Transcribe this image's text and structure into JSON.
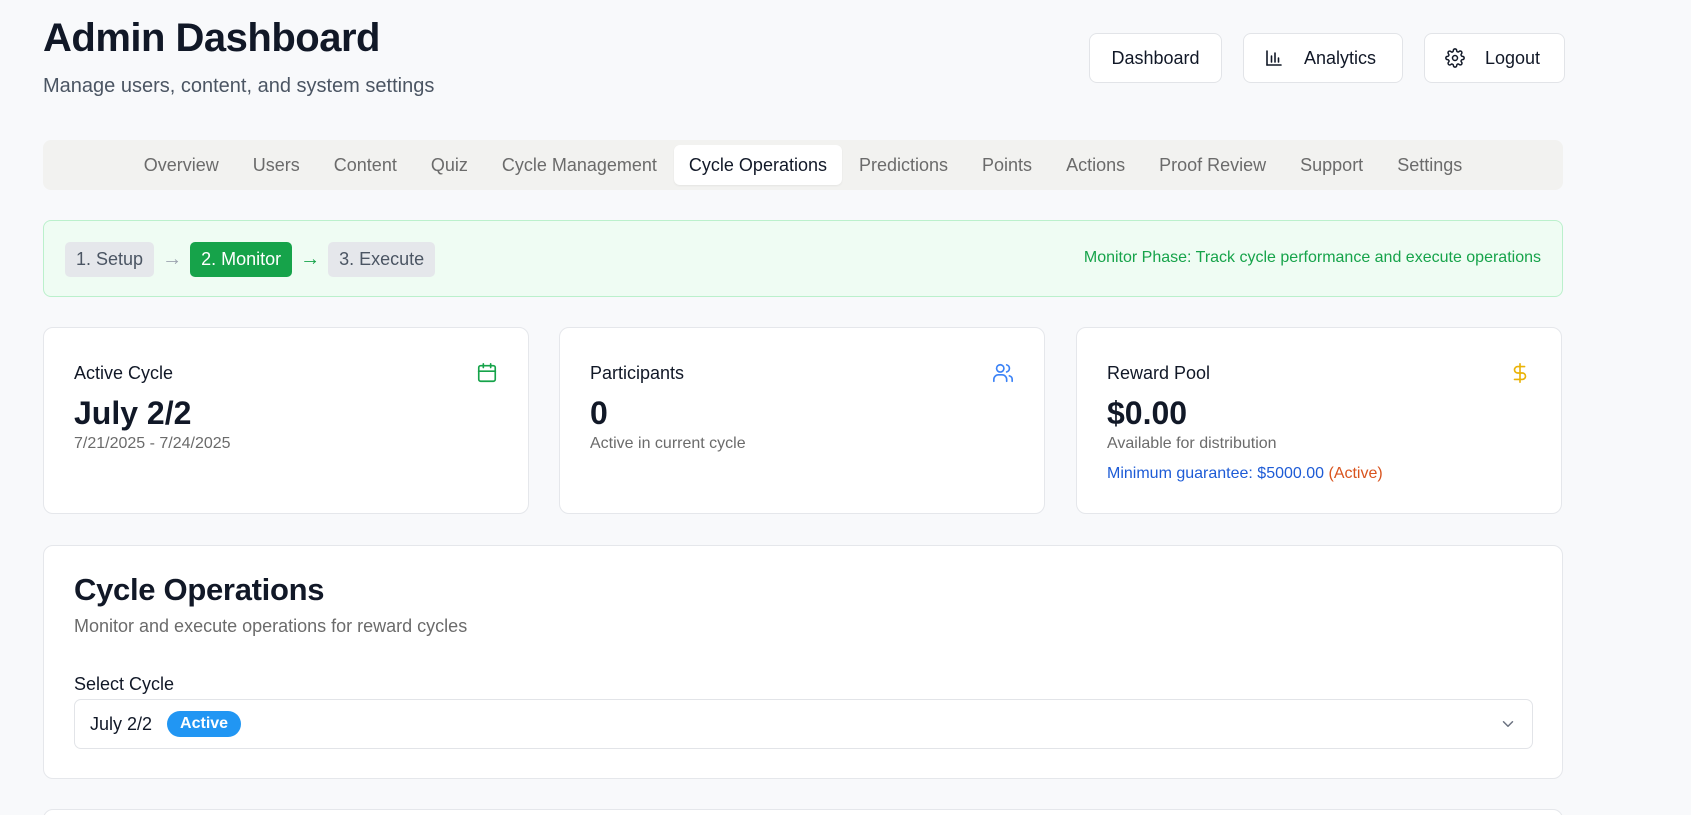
{
  "header": {
    "title": "Admin Dashboard",
    "subtitle": "Manage users, content, and system settings"
  },
  "top_buttons": {
    "dashboard": "Dashboard",
    "analytics": "Analytics",
    "logout": "Logout"
  },
  "tabs": [
    {
      "label": "Overview"
    },
    {
      "label": "Users"
    },
    {
      "label": "Content"
    },
    {
      "label": "Quiz"
    },
    {
      "label": "Cycle Management"
    },
    {
      "label": "Cycle Operations",
      "active": true
    },
    {
      "label": "Predictions"
    },
    {
      "label": "Points"
    },
    {
      "label": "Actions"
    },
    {
      "label": "Proof Review"
    },
    {
      "label": "Support"
    },
    {
      "label": "Settings"
    }
  ],
  "phase": {
    "steps": [
      "1. Setup",
      "2. Monitor",
      "3. Execute"
    ],
    "arrow": "→",
    "message": "Monitor Phase: Track cycle performance and execute operations"
  },
  "cards": {
    "active_cycle": {
      "label": "Active Cycle",
      "value": "July 2/2",
      "sub": "7/21/2025 - 7/24/2025",
      "icon": "calendar-icon"
    },
    "participants": {
      "label": "Participants",
      "value": "0",
      "sub": "Active in current cycle",
      "icon": "users-icon"
    },
    "reward_pool": {
      "label": "Reward Pool",
      "value": "$0.00",
      "sub": "Available for distribution",
      "note": "Minimum guarantee: $5000.00",
      "note_status": "(Active)",
      "icon": "dollar-icon"
    }
  },
  "operations": {
    "title": "Cycle Operations",
    "description": "Monitor and execute operations for reward cycles",
    "select_label": "Select Cycle",
    "selected_cycle": "July 2/2",
    "selected_badge": "Active"
  },
  "colors": {
    "green": "#16a34a",
    "blue_icon": "#3b82f6",
    "yellow_icon": "#eab308",
    "badge_blue": "#2196f3"
  }
}
